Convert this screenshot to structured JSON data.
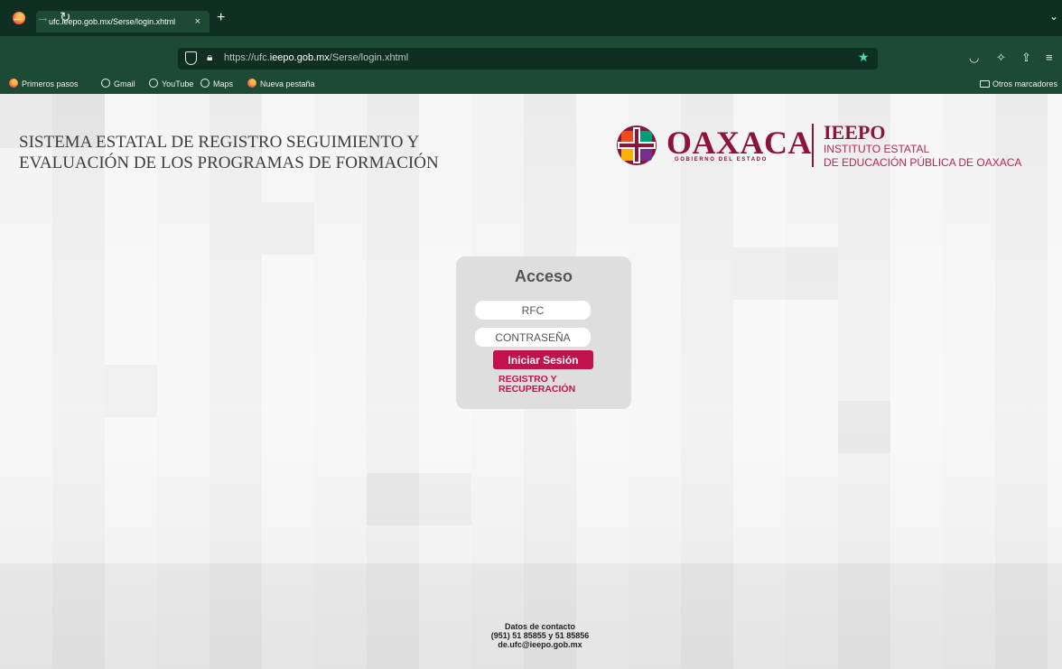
{
  "browser": {
    "tab_title": "ufc.ieepo.gob.mx/Serse/login.xhtml",
    "tab_close": "×",
    "new_tab": "+",
    "tabs_menu": "⌄",
    "back": "←",
    "forward": "→",
    "reload": "↻",
    "url_prefix": "https://ufc.",
    "url_domain": "ieepo.gob.mx",
    "url_path": "/Serse/login.xhtml",
    "bookmarks": [
      "Primeros pasos",
      "Gmail",
      "YouTube",
      "Maps",
      "Nueva pestaña"
    ],
    "other_bookmarks": "Otros marcadores",
    "accent": "#3fe1b0",
    "chrome_color": "#1c4a35"
  },
  "header": {
    "title_line1": "SISTEMA ESTATAL DE REGISTRO SEGUIMIENTO Y",
    "title_line2": "EVALUACIÓN DE LOS PROGRAMAS DE FORMACIÓN",
    "brand_name": "OAXACA",
    "brand_sub": "GOBIERNO DEL ESTADO",
    "ieepo": "IEEPO",
    "ieepo_line1": "INSTITUTO ESTATAL",
    "ieepo_line2": "DE EDUCACIÓN PÚBLICA DE OAXACA",
    "brand_color": "#8a1538"
  },
  "login": {
    "title": "Acceso",
    "rfc_placeholder": "RFC",
    "password_placeholder": "CONTRASEÑA",
    "submit_label": "Iniciar Sesión",
    "register_line1": "REGISTRO Y",
    "register_line2": "RECUPERACIÓN",
    "button_color": "#c2124e"
  },
  "footer": {
    "line1": "Datos de contacto",
    "line2": "(951) 51 85855 y 51 85856",
    "line3": "de.ufc@ieepo.gob.mx"
  }
}
